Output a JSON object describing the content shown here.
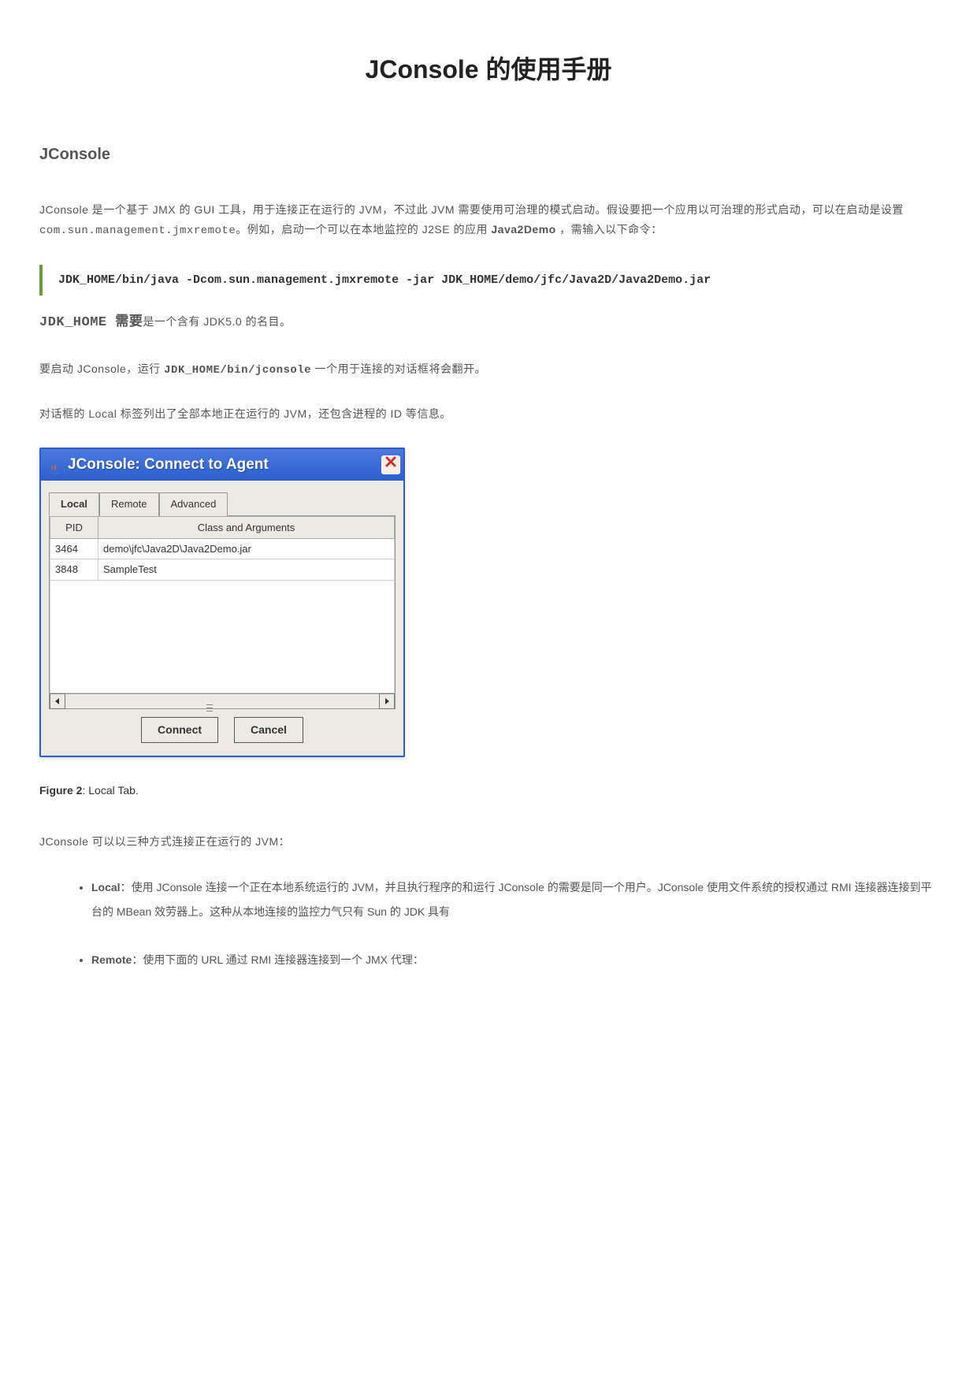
{
  "title": "JConsole 的使用手册",
  "section": "JConsole",
  "intro1_a": "JConsole 是一个基于 JMX 的 GUI 工具，用于连接正在运行的 JVM，不过此 JVM 需要使用可治理的模式启动。假设要把一个应用以可治理的形式启动，可以在启动是设置 ",
  "intro1_mono": "com.sun.management.jmxremote",
  "intro1_b": "。例如，启动一个可以在本地监控的 J2SE 的应用 ",
  "intro1_bold": "Java2Demo",
  "intro1_c": " ，需输入以下命令：",
  "command": "JDK_HOME/bin/java -Dcom.sun.management.jmxremote -jar JDK_HOME/demo/jfc/Java2D/Java2Demo.jar",
  "jdkhome_a": "JDK_HOME 需要",
  "jdkhome_b": "是一个含有 JDK5.0 的名目。",
  "run_a": "要启动 JConsole，运行    ",
  "run_b": "JDK_HOME/bin/jconsole",
  "run_c": " 一个用于连接的对话框将会翻开。",
  "localtab_text": "对话框的 Local 标签列出了全部本地正在运行的 JVM，还包含进程的 ID 等信息。",
  "dialog": {
    "title": "JConsole: Connect to Agent",
    "tabs": {
      "local": "Local",
      "remote": "Remote",
      "advanced": "Advanced"
    },
    "headers": {
      "pid": "PID",
      "args": "Class and Arguments"
    },
    "rows": [
      {
        "pid": "3464",
        "args": "demo\\jfc\\Java2D\\Java2Demo.jar"
      },
      {
        "pid": "3848",
        "args": "SampleTest"
      }
    ],
    "connect": "Connect",
    "cancel": "Cancel"
  },
  "figcap_a": "Figure 2",
  "figcap_b": ": Local Tab.",
  "conn_intro": "JConsole 可以以三种方式连接正在运行的 JVM：",
  "bullets": {
    "local_l": "Local",
    "local_t": "：使用 JConsole 连接一个正在本地系统运行的 JVM，并且执行程序的和运行 JConsole 的需要是同一个用户。JConsole 使用文件系统的授权通过 RMI 连接器连接到平台的 MBean 效劳器上。这种从本地连接的监控力气只有 Sun 的 JDK 具有",
    "remote_l": "Remote",
    "remote_t": "：使用下面的 URL 通过 RMI 连接器连接到一个 JMX 代理："
  }
}
